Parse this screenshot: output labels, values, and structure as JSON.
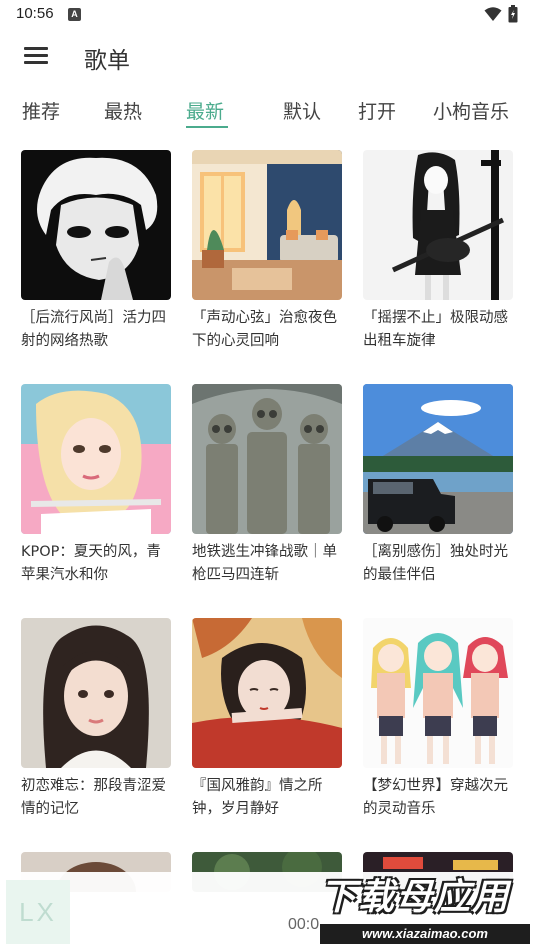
{
  "status_bar": {
    "time": "10:56",
    "notification_letter": "A"
  },
  "app_bar": {
    "title": "歌单"
  },
  "tabs": [
    {
      "label": "推荐",
      "active": false
    },
    {
      "label": "最热",
      "active": false
    },
    {
      "label": "最新",
      "active": true
    },
    {
      "label": "默认",
      "active": false
    },
    {
      "label": "打开",
      "active": false
    },
    {
      "label": "小枸音乐",
      "active": false
    }
  ],
  "playlists": [
    {
      "title": "［后流行风尚］活力四射的网络热歌",
      "cover": "anime-boy-icon"
    },
    {
      "title": "「声动心弦」治愈夜色下的心灵回响",
      "cover": "cozy-room-icon"
    },
    {
      "title": "「摇摆不止」极限动感出租车旋律",
      "cover": "guitar-girl-icon"
    },
    {
      "title": "KPOP：夏天的风，青苹果汽水和你",
      "cover": "blonde-girl-icon"
    },
    {
      "title": "地铁逃生冲锋战歌｜单枪匹马四连斩",
      "cover": "soldiers-icon"
    },
    {
      "title": "［离别感伤］独处时光的最佳伴侣",
      "cover": "mountain-car-icon"
    },
    {
      "title": "初恋难忘：那段青涩爱情的记忆",
      "cover": "portrait-girl-icon"
    },
    {
      "title": "『国风雅韵』情之所钟，岁月静好",
      "cover": "guofeng-girl-icon"
    },
    {
      "title": "【梦幻世界】穿越次元的灵动音乐",
      "cover": "anime-trio-icon"
    }
  ],
  "player": {
    "logo_text": "LX",
    "time": "00:0"
  },
  "watermark": {
    "main": "下载母应用",
    "url": "www.xiazaimao.com"
  },
  "colors": {
    "accent": "#4bab8d",
    "text": "#333333",
    "background": "#ffffff"
  }
}
